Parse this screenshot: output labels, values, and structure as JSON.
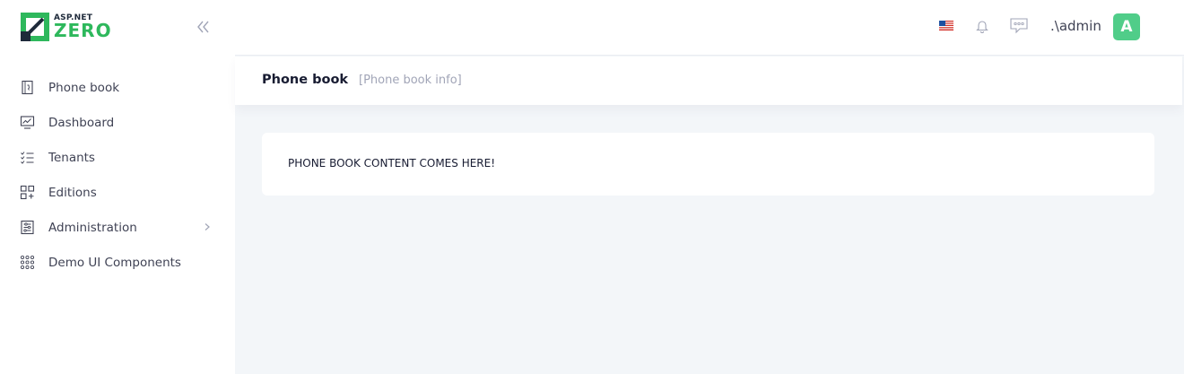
{
  "brand": {
    "small_text": "ASP.NET",
    "big_text": "ZERO",
    "accent_color": "#2eb85c",
    "dark_color": "#1e2a3a"
  },
  "sidebar": {
    "collapse_icon": "double-chevron-left-icon",
    "items": [
      {
        "label": "Phone book",
        "icon": "phone-book-icon"
      },
      {
        "label": "Dashboard",
        "icon": "dashboard-icon"
      },
      {
        "label": "Tenants",
        "icon": "tenants-list-icon"
      },
      {
        "label": "Editions",
        "icon": "editions-grid-icon"
      },
      {
        "label": "Administration",
        "icon": "administration-icon",
        "has_submenu": true
      },
      {
        "label": "Demo UI Components",
        "icon": "components-dots-icon"
      }
    ]
  },
  "topbar": {
    "language_icon": "us-flag-icon",
    "notifications_icon": "bell-icon",
    "chat_icon": "chat-icon",
    "user_name": ".\\admin",
    "avatar_letter": "A",
    "avatar_color": "#50cd89"
  },
  "subheader": {
    "title": "Phone book",
    "description": "[Phone book info]"
  },
  "content": {
    "text": "PHONE BOOK CONTENT COMES HERE!"
  }
}
